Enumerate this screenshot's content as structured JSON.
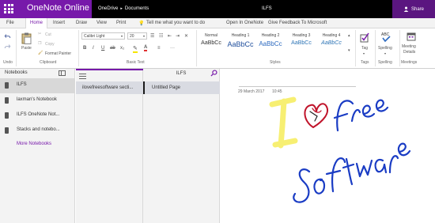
{
  "app": {
    "title": "OneNote Online"
  },
  "breadcrumb": {
    "root": "OneDrive",
    "folder": "Documents"
  },
  "document": {
    "title": "ILFS"
  },
  "share": {
    "label": "Share"
  },
  "tabs": [
    "File",
    "Home",
    "Insert",
    "Draw",
    "View",
    "Print"
  ],
  "tell_me": "Tell me what you want to do",
  "open_in_onenote": "Open In OneNote",
  "feedback": "Give Feedback To Microsoft",
  "ribbon": {
    "undo_label": "Undo",
    "paste_label": "Paste",
    "cut_label": "Cut",
    "copy_label": "Copy",
    "format_painter_label": "Format Painter",
    "clipboard_group": "Clipboard",
    "font_name": "Calibri Light",
    "font_size": "20",
    "basic_text_group": "Basic Text",
    "styles": [
      {
        "name": "Normal",
        "preview": "AaBbCc",
        "color": "#333333"
      },
      {
        "name": "Heading 1",
        "preview": "AaBbCc",
        "color": "#1f4e9c"
      },
      {
        "name": "Heading 2",
        "preview": "AaBbCc",
        "color": "#2e6bc0"
      },
      {
        "name": "Heading 3",
        "preview": "AaBbCc",
        "color": "#2e75b6"
      },
      {
        "name": "Heading 4",
        "preview": "AaBbCc",
        "color": "#2e75b6"
      }
    ],
    "styles_group": "Styles",
    "tag_label": "Tag",
    "tags_group": "Tags",
    "spelling_label": "Spelling",
    "spelling_group": "Spelling",
    "meeting_label_1": "Meeting",
    "meeting_label_2": "Details",
    "meetings_group": "Meetings"
  },
  "notebooks": {
    "title": "Notebooks",
    "items": [
      "ILFS",
      "laxman's Notebook",
      "ILFS OneNote Not...",
      "Stacks and notebo..."
    ],
    "more": "More Notebooks"
  },
  "sections": {
    "items": [
      "ilovefreesoftware secti..."
    ]
  },
  "pages": {
    "pane_title": "ILFS",
    "items": [
      "Untitled Page"
    ]
  },
  "page": {
    "date": "29 March 2017",
    "time": "10:45"
  },
  "colors": {
    "brand": "#7719aa",
    "ink_blue": "#1a3cc4",
    "ink_highlighter": "#f7ef6b",
    "ink_heart": "#c0132a"
  }
}
